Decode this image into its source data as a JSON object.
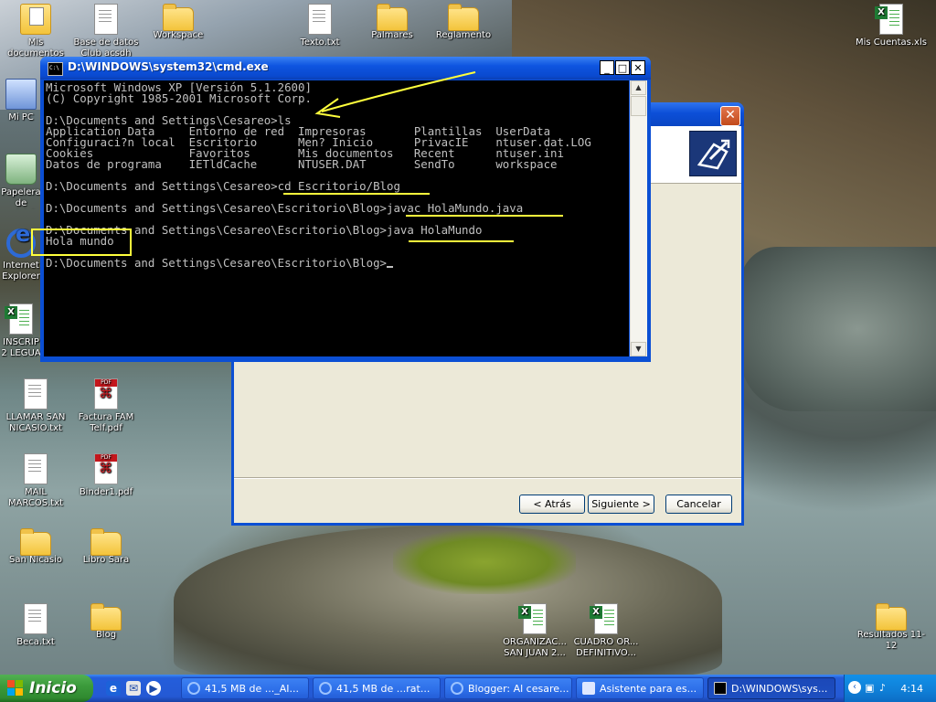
{
  "desktop": {
    "icons": [
      {
        "label": "Mis documentos",
        "type": "my-documents"
      },
      {
        "label": "Base de datos Club acsdh",
        "type": "database"
      },
      {
        "label": "Workspace",
        "type": "folder"
      },
      {
        "label": "Texto.txt",
        "type": "text-file"
      },
      {
        "label": "Palmares",
        "type": "folder"
      },
      {
        "label": "Reglamento",
        "type": "folder"
      },
      {
        "label": "Mis Cuentas.xls",
        "type": "excel-file"
      },
      {
        "label": "Mi PC",
        "type": "my-computer"
      },
      {
        "label": "Papelera de reciclaje",
        "type": "recycle-bin"
      },
      {
        "label": "Internet Explorer",
        "type": "internet-explorer"
      },
      {
        "label": "INSCRIP 2 LEGUA",
        "type": "excel-file"
      },
      {
        "label": "LLAMAR SAN NICASIO.txt",
        "type": "text-file"
      },
      {
        "label": "Factura FAM Telf.pdf",
        "type": "pdf-file"
      },
      {
        "label": "MAIL MARCOS.txt",
        "type": "text-file"
      },
      {
        "label": "Binder1.pdf",
        "type": "pdf-file"
      },
      {
        "label": "San Nicasio",
        "type": "folder"
      },
      {
        "label": "Libro Sara",
        "type": "folder"
      },
      {
        "label": "Beca.txt",
        "type": "text-file"
      },
      {
        "label": "Blog",
        "type": "folder"
      },
      {
        "label": "ORGANIZAC... SAN JUAN 2...",
        "type": "excel-file"
      },
      {
        "label": "CUADRO OR... DEFINITIVO...",
        "type": "excel-file"
      },
      {
        "label": "Resultados 11-12",
        "type": "folder"
      }
    ]
  },
  "cmd_window": {
    "title": "D:\\WINDOWS\\system32\\cmd.exe",
    "icon": "console-icon",
    "lines": [
      "Microsoft Windows XP [Versión 5.1.2600]",
      "(C) Copyright 1985-2001 Microsoft Corp.",
      "",
      "D:\\Documents and Settings\\Cesareo>ls",
      "Application Data     Entorno de red  Impresoras       Plantillas  UserData",
      "Configuraci?n local  Escritorio      Men? Inicio      PrivacIE    ntuser.dat.LOG",
      "Cookies              Favoritos       Mis documentos   Recent      ntuser.ini",
      "Datos de programa    IETldCache      NTUSER.DAT       SendTo      workspace",
      "",
      "D:\\Documents and Settings\\Cesareo>cd Escritorio/Blog",
      "",
      "D:\\Documents and Settings\\Cesareo\\Escritorio\\Blog>javac HolaMundo.java",
      "",
      "D:\\Documents and Settings\\Cesareo\\Escritorio\\Blog>java HolaMundo",
      "Hola mundo",
      "",
      "D:\\Documents and Settings\\Cesareo\\Escritorio\\Blog>"
    ],
    "colors": {
      "background": "#000000",
      "text": "#c0c0c0"
    }
  },
  "wizard_dialog": {
    "close_label": "✕",
    "back_label": "< Atrás",
    "next_label": "Siguiente >",
    "cancel_label": "Cancelar",
    "logo_icon": "wizard-logo-icon"
  },
  "annotations": {
    "color": "#ffff3c",
    "arrow": "pointing to the copyright line",
    "underlines": [
      "cd Escritorio/Blog",
      "javac HolaMundo.java",
      "java HolaMundo"
    ],
    "boxed_text": "Hola mundo"
  },
  "taskbar": {
    "start_label": "Inicio",
    "quick_launch": [
      "internet-explorer-icon",
      "outlook-icon",
      "media-player-icon"
    ],
    "buttons": [
      {
        "label": "41,5 MB de ..._AI...",
        "icon": "internet-explorer-icon",
        "active": false
      },
      {
        "label": "41,5 MB de ...rat...",
        "icon": "internet-explorer-icon",
        "active": false
      },
      {
        "label": "Blogger: Al cesare...",
        "icon": "internet-explorer-icon",
        "active": false
      },
      {
        "label": "Asistente para es...",
        "icon": "wizard-icon",
        "active": false
      },
      {
        "label": "D:\\WINDOWS\\sys...",
        "icon": "console-icon",
        "active": true
      }
    ],
    "tray_icons": [
      "expand-tray-icon",
      "network-icon",
      "volume-icon"
    ],
    "clock": "4:14",
    "colors": {
      "bar": "#245edb",
      "start": "#3c9b3c"
    }
  }
}
